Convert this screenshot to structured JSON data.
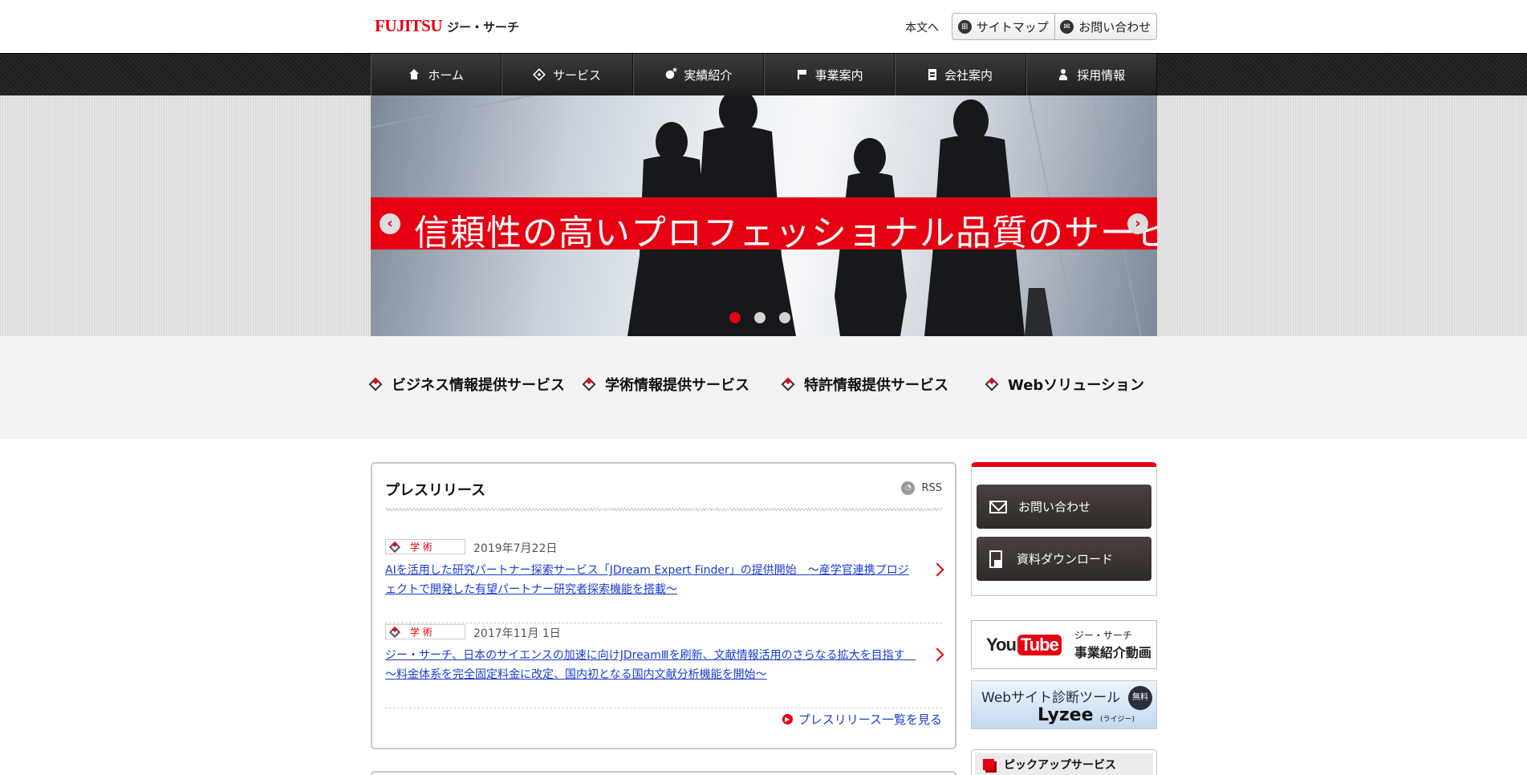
{
  "header": {
    "logo_brand": "FUJITSU",
    "logo_name": "ジー・サーチ",
    "skip_link": "本文へ",
    "sitemap_label": "サイトマップ",
    "contact_label": "お問い合わせ"
  },
  "nav": {
    "items": [
      {
        "label": "ホーム",
        "icon": "home-icon"
      },
      {
        "label": "サービス",
        "icon": "service-icon"
      },
      {
        "label": "実績紹介",
        "icon": "results-icon"
      },
      {
        "label": "事業案内",
        "icon": "business-icon"
      },
      {
        "label": "会社案内",
        "icon": "building-icon"
      },
      {
        "label": "採用情報",
        "icon": "person-icon"
      }
    ]
  },
  "hero": {
    "caption": "信頼性の高いプロフェッショナル品質のサービスを",
    "prev_label": "‹",
    "next_label": "›",
    "slide_count": 3,
    "active_slide": 1
  },
  "services": {
    "items": [
      {
        "label": "ビジネス情報提供サービス"
      },
      {
        "label": "学術情報提供サービス"
      },
      {
        "label": "特許情報提供サービス"
      },
      {
        "label": "Webソリューション"
      }
    ]
  },
  "press": {
    "title": "プレスリリース",
    "rss_label": "RSS",
    "items": [
      {
        "tag": "学 術",
        "date": "2019年7月22日",
        "title": "AIを活用した研究パートナー探索サービス「JDream Expert Finder」の提供開始　～産学官連携プロジェクトで開発した有望パートナー研究者探索機能を搭載～"
      },
      {
        "tag": "学 術",
        "date": "2017年11月 1日",
        "title": "ジー・サーチ、日本のサイエンスの加速に向けJDreamⅢを刷新、文献情報活用のさらなる拡大を目指す　～料金体系を完全固定料金に改定、国内初となる国内文献分析機能を開始～"
      }
    ],
    "more_label": "プレスリリース一覧を見る"
  },
  "sidebar": {
    "contact_button": "お問い合わせ",
    "download_button": "資料ダウンロード",
    "youtube": {
      "logo_you": "You",
      "logo_tube": "Tube",
      "subtitle": "ジー・サーチ",
      "title": "事業紹介動画"
    },
    "lyzee": {
      "title": "Webサイト診断ツール",
      "badge": "無料",
      "name": "Lyzee",
      "kana": "(ライジー)"
    },
    "pickup_title": "ピックアップサービス"
  },
  "colors": {
    "brand_red": "#e60012",
    "nav_dark": "#222222",
    "link_blue": "#1a3cd0"
  }
}
